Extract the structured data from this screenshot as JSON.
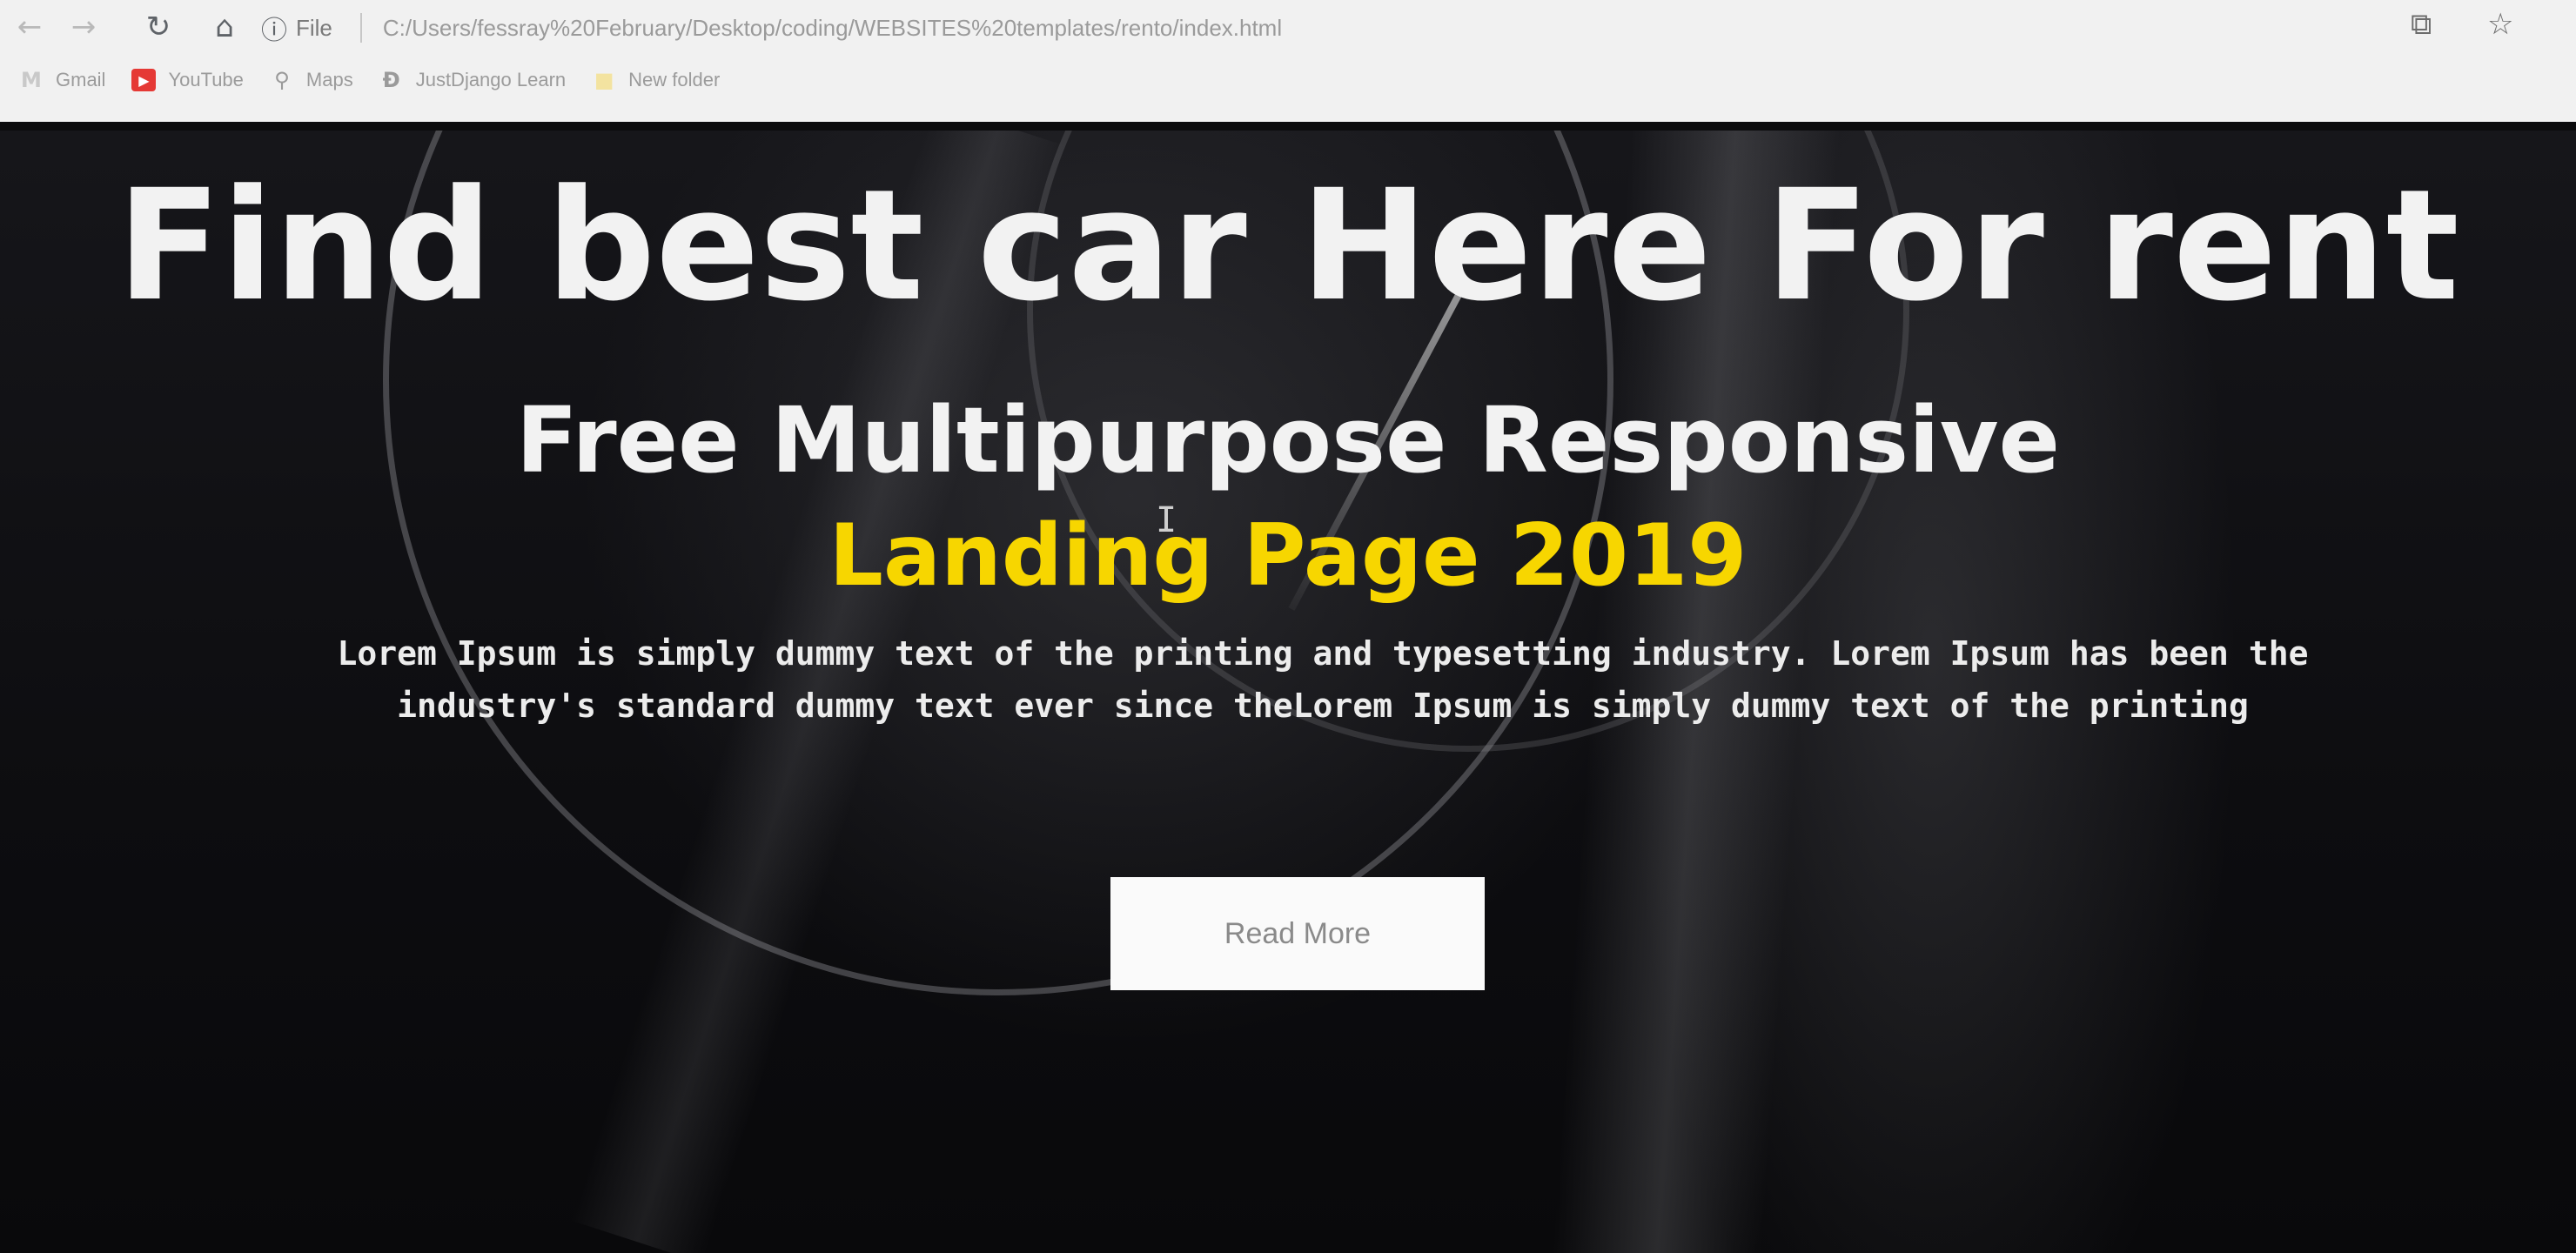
{
  "browser": {
    "back_icon": "arrow-left-icon",
    "forward_icon": "arrow-right-icon",
    "reload_icon": "reload-icon",
    "home_icon": "home-icon",
    "info_icon": "info-icon",
    "scheme_label": "File",
    "url": "C:/Users/fessray%20February/Desktop/coding/WEBSITES%20templates/rento/index.html",
    "bookmark_page_icon": "page-action-icon",
    "star_icon": "star-icon",
    "bookmarks": [
      {
        "label": "Gmail",
        "icon": "gmail-icon",
        "glyph": "M",
        "color": "#c9c9c9"
      },
      {
        "label": "YouTube",
        "icon": "youtube-icon",
        "glyph": "▶",
        "color": "#e53935"
      },
      {
        "label": "Maps",
        "icon": "maps-pin-icon",
        "glyph": "⚲",
        "color": "#9a9a9a"
      },
      {
        "label": "JustDjango Learn",
        "icon": "justdjango-icon",
        "glyph": "Ɖ",
        "color": "#9a9a9a"
      },
      {
        "label": "New folder",
        "icon": "folder-icon",
        "glyph": "■",
        "color": "#f3e3a0"
      }
    ]
  },
  "hero": {
    "title": "Find best car Here For rent",
    "subtitle": "Free Multipurpose Responsive",
    "highlight": "Landing Page 2019",
    "body_line1": "Lorem Ipsum is simply dummy text of the printing and typesetting industry. Lorem Ipsum has been the",
    "body_line2": "industry's standard dummy text ever since theLorem Ipsum is simply dummy text of the printing",
    "button_label": "Read More"
  },
  "colors": {
    "highlight": "#f7d600",
    "hero_bg": "#0b0b0d",
    "button_bg": "#fafafa"
  }
}
